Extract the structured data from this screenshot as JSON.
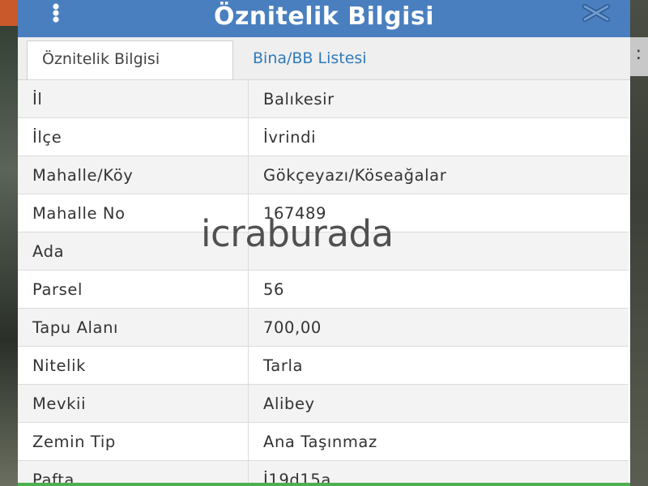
{
  "dialog": {
    "title": "Öznitelik Bilgisi",
    "tabs": [
      {
        "label": "Öznitelik Bilgisi",
        "active": true
      },
      {
        "label": "Bina/BB Listesi",
        "active": false
      }
    ],
    "rows": [
      {
        "key": "İl",
        "value": "Balıkesir"
      },
      {
        "key": "İlçe",
        "value": "İvrindi"
      },
      {
        "key": "Mahalle/Köy",
        "value": "Gökçeyazı/Köseağalar"
      },
      {
        "key": "Mahalle No",
        "value": "167489"
      },
      {
        "key": "Ada",
        "value": ""
      },
      {
        "key": "Parsel",
        "value": "56"
      },
      {
        "key": "Tapu Alanı",
        "value": "700,00"
      },
      {
        "key": "Nitelik",
        "value": "Tarla"
      },
      {
        "key": "Mevkii",
        "value": "Alibey"
      },
      {
        "key": "Zemin Tip",
        "value": "Ana Taşınmaz"
      },
      {
        "key": "Pafta",
        "value": "İ19d15a"
      }
    ]
  },
  "watermark": "icraburada",
  "icons": {
    "menu": "vertical-dots-icon",
    "close": "close-icon"
  },
  "colors": {
    "titlebar": "#4a7fbf",
    "tab_link": "#2f7ab8"
  }
}
